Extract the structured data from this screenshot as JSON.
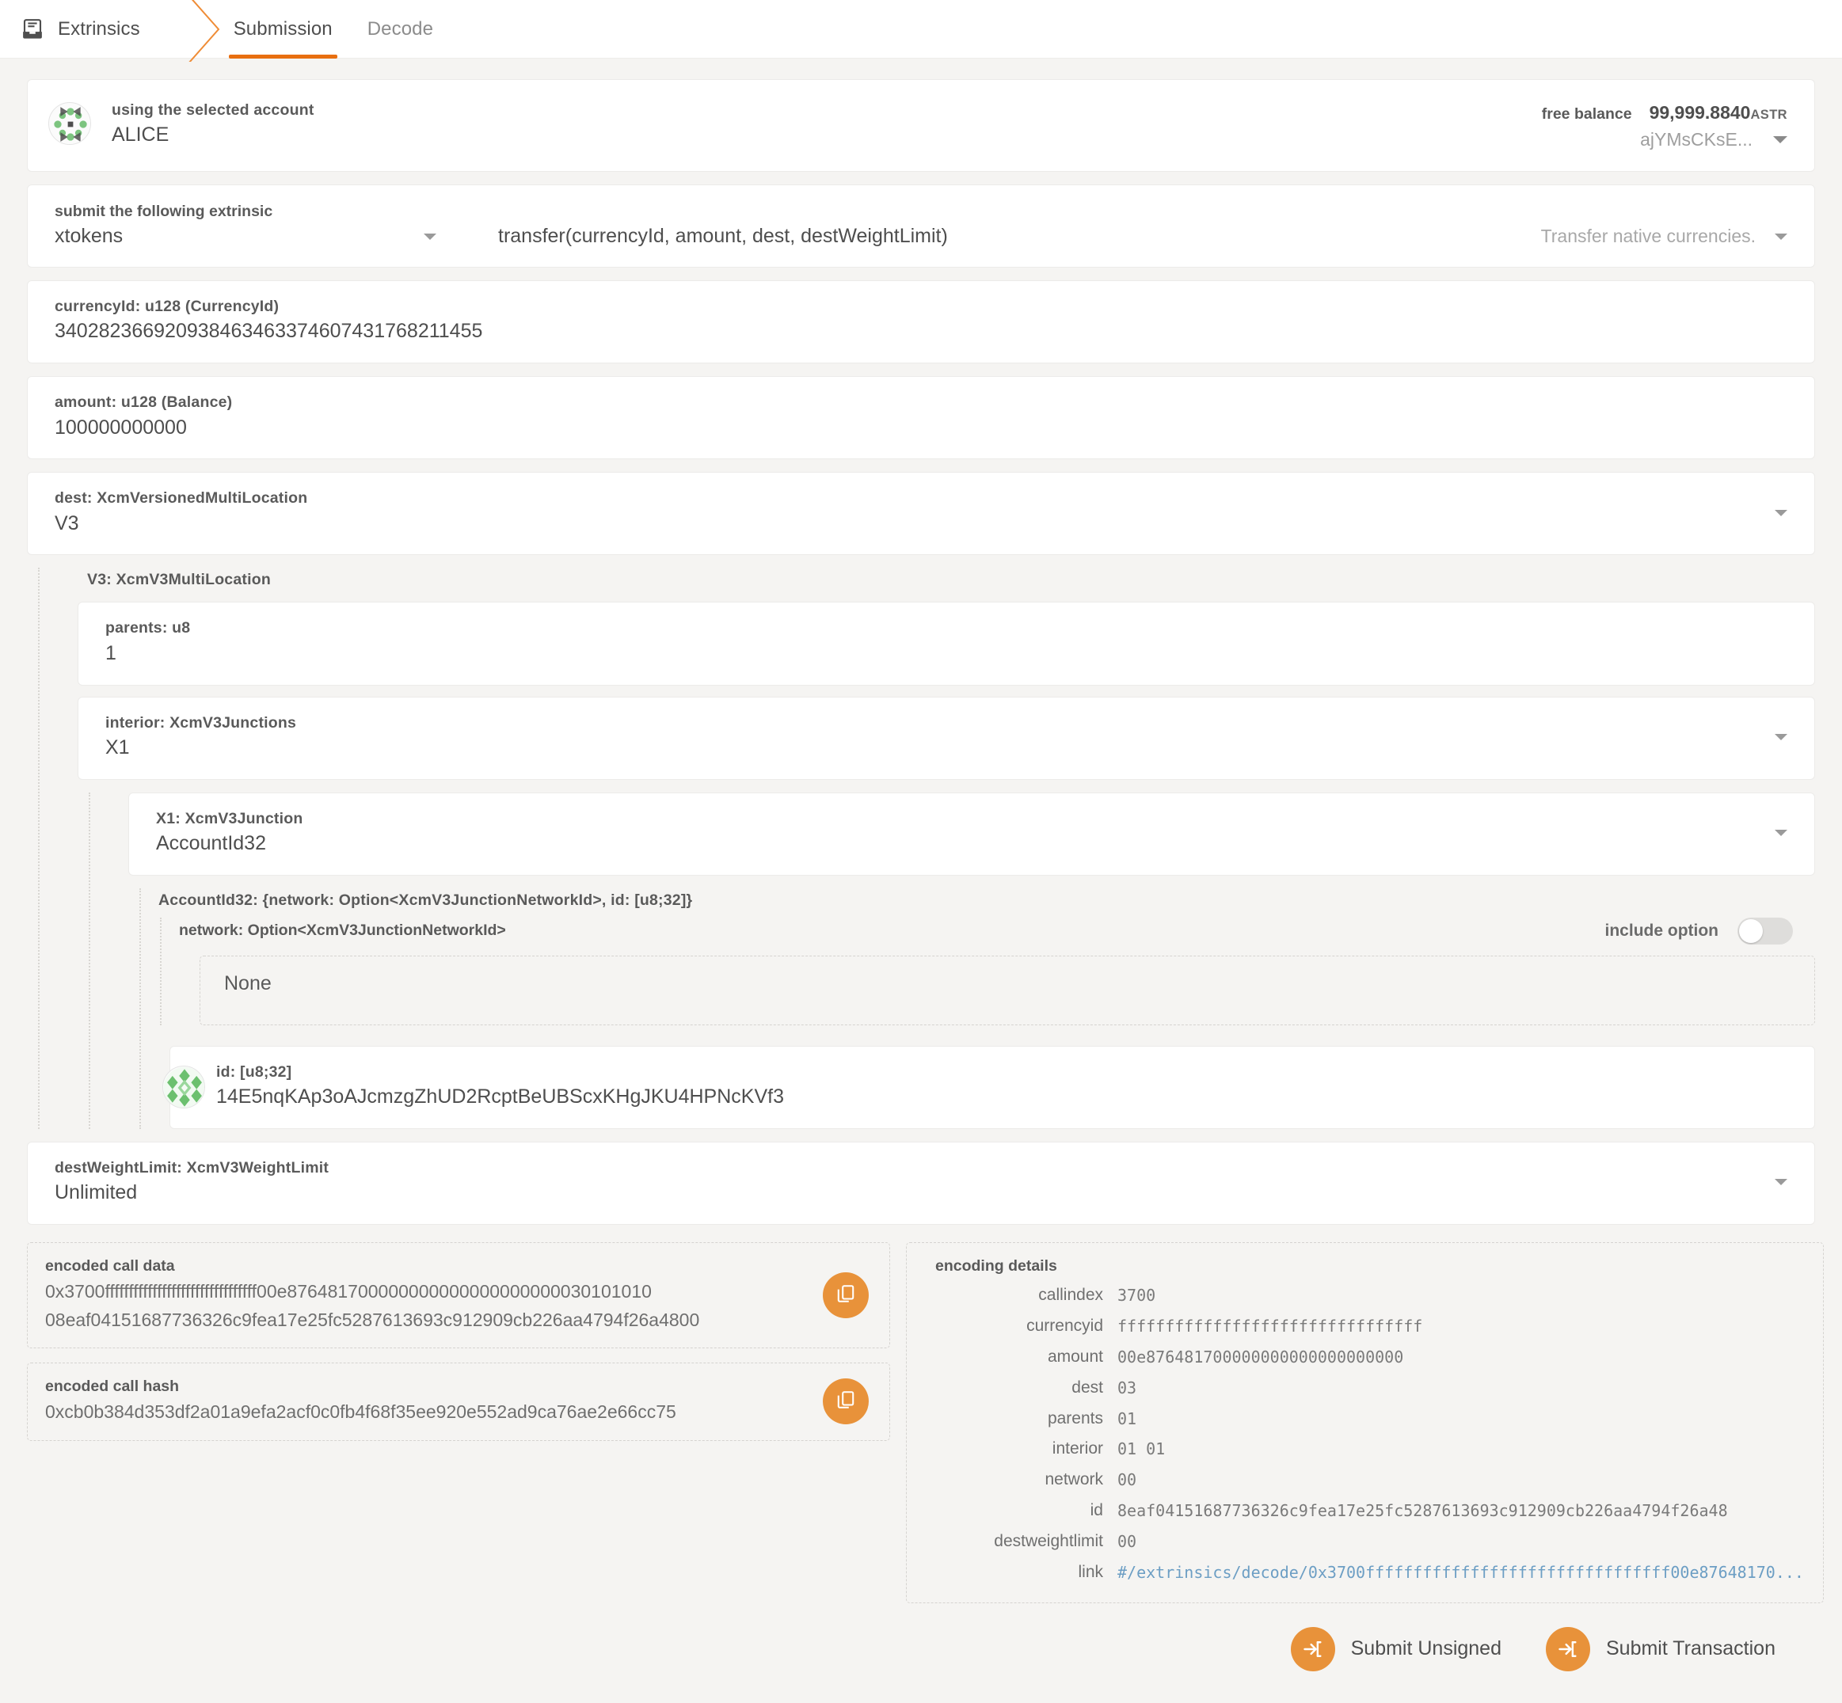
{
  "topbar": {
    "breadcrumb": "Extrinsics",
    "breadcrumb_icon": "extrinsics-box-icon",
    "tabs": [
      {
        "label": "Submission",
        "active": true
      },
      {
        "label": "Decode",
        "active": false
      }
    ]
  },
  "account": {
    "label": "using the selected account",
    "value": "ALICE",
    "balance_label": "free balance",
    "balance_amount": "99,999.8840",
    "balance_unit": "ASTR",
    "account_short": "ajYMsCKsE..."
  },
  "extrinsic": {
    "label": "submit the following extrinsic",
    "module": "xtokens",
    "method": "transfer(currencyId, amount, dest, destWeightLimit)",
    "doc": "Transfer native currencies."
  },
  "params": {
    "currencyId": {
      "label": "currencyId: u128 (CurrencyId)",
      "value": "340282366920938463463374607431768211455"
    },
    "amount": {
      "label": "amount: u128 (Balance)",
      "value": "100000000000"
    },
    "dest": {
      "label": "dest: XcmVersionedMultiLocation",
      "value": "V3"
    },
    "v3": {
      "title": "V3: XcmV3MultiLocation",
      "parents": {
        "label": "parents: u8",
        "value": "1"
      },
      "interior": {
        "label": "interior: XcmV3Junctions",
        "value": "X1"
      },
      "x1": {
        "label": "X1: XcmV3Junction",
        "value": "AccountId32"
      },
      "accountId32": {
        "title": "AccountId32: {network: Option<XcmV3JunctionNetworkId>, id: [u8;32]}",
        "network": {
          "label": "network: Option<XcmV3JunctionNetworkId>",
          "include_option_label": "include option",
          "value": "None"
        },
        "id": {
          "label": "id: [u8;32]",
          "value": "14E5nqKAp3oAJcmzgZhUD2RcptBeUBScxKHgJKU4HPNcKVf3"
        }
      }
    },
    "destWeightLimit": {
      "label": "destWeightLimit: XcmV3WeightLimit",
      "value": "Unlimited"
    }
  },
  "encoded": {
    "call_data_label": "encoded call data",
    "call_data_line1": "0x3700ffffffffffffffffffffffffffffffff00e876481700000000000000000000030101010",
    "call_data_line2": "08eaf04151687736326c9fea17e25fc5287613693c912909cb226aa4794f26a4800",
    "call_hash_label": "encoded call hash",
    "call_hash": "0xcb0b384d353df2a01a9efa2acf0c0fb4f68f35ee920e552ad9ca76ae2e66cc75",
    "copy_icon": "copy-icon"
  },
  "details": {
    "title": "encoding details",
    "rows": [
      {
        "key": "callindex",
        "value": "3700"
      },
      {
        "key": "currencyid",
        "value": "ffffffffffffffffffffffffffffffff"
      },
      {
        "key": "amount",
        "value": "00e876481700000000000000000000"
      },
      {
        "key": "dest",
        "value": "03"
      },
      {
        "key": "parents",
        "value": "01"
      },
      {
        "key": "interior",
        "value": "01 01"
      },
      {
        "key": "network",
        "value": "00"
      },
      {
        "key": "id",
        "value": "8eaf04151687736326c9fea17e25fc5287613693c912909cb226aa4794f26a48"
      },
      {
        "key": "destweightlimit",
        "value": "00"
      }
    ],
    "link_key": "link",
    "link_value": "#/extrinsics/decode/0x3700ffffffffffffffffffffffffffffffff00e87648170..."
  },
  "footer": {
    "submit_unsigned": "Submit Unsigned",
    "submit_transaction": "Submit Transaction",
    "submit_icon": "sign-in-arrow-icon"
  },
  "colors": {
    "accent": "#e8923a",
    "tab_underline": "#e86f10",
    "link": "#6c9ec4"
  }
}
